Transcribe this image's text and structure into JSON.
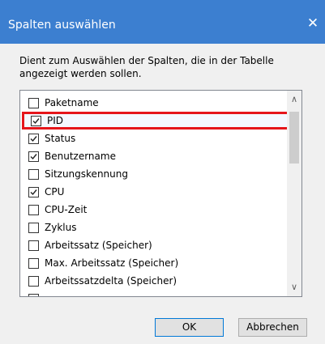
{
  "dialog": {
    "title": "Spalten auswählen",
    "close_glyph": "✕",
    "description": "Dient zum Auswählen der Spalten, die in der Tabelle angezeigt werden sollen."
  },
  "list": {
    "items": [
      {
        "label": "Paketname",
        "checked": false,
        "highlighted": false
      },
      {
        "label": "PID",
        "checked": true,
        "highlighted": true
      },
      {
        "label": "Status",
        "checked": true,
        "highlighted": false
      },
      {
        "label": "Benutzername",
        "checked": true,
        "highlighted": false
      },
      {
        "label": "Sitzungskennung",
        "checked": false,
        "highlighted": false
      },
      {
        "label": "CPU",
        "checked": true,
        "highlighted": false
      },
      {
        "label": "CPU-Zeit",
        "checked": false,
        "highlighted": false
      },
      {
        "label": "Zyklus",
        "checked": false,
        "highlighted": false
      },
      {
        "label": "Arbeitssatz (Speicher)",
        "checked": false,
        "highlighted": false
      },
      {
        "label": "Max. Arbeitssatz (Speicher)",
        "checked": false,
        "highlighted": false
      },
      {
        "label": "Arbeitssatzdelta (Speicher)",
        "checked": false,
        "highlighted": false
      },
      {
        "label": "",
        "checked": false,
        "highlighted": false
      }
    ],
    "scroll_up_glyph": "∧",
    "scroll_down_glyph": "∨"
  },
  "buttons": {
    "ok_label": "OK",
    "cancel_label": "Abbrechen"
  },
  "colors": {
    "titlebar": "#3c7fd0",
    "highlight_border": "#e5151b"
  }
}
